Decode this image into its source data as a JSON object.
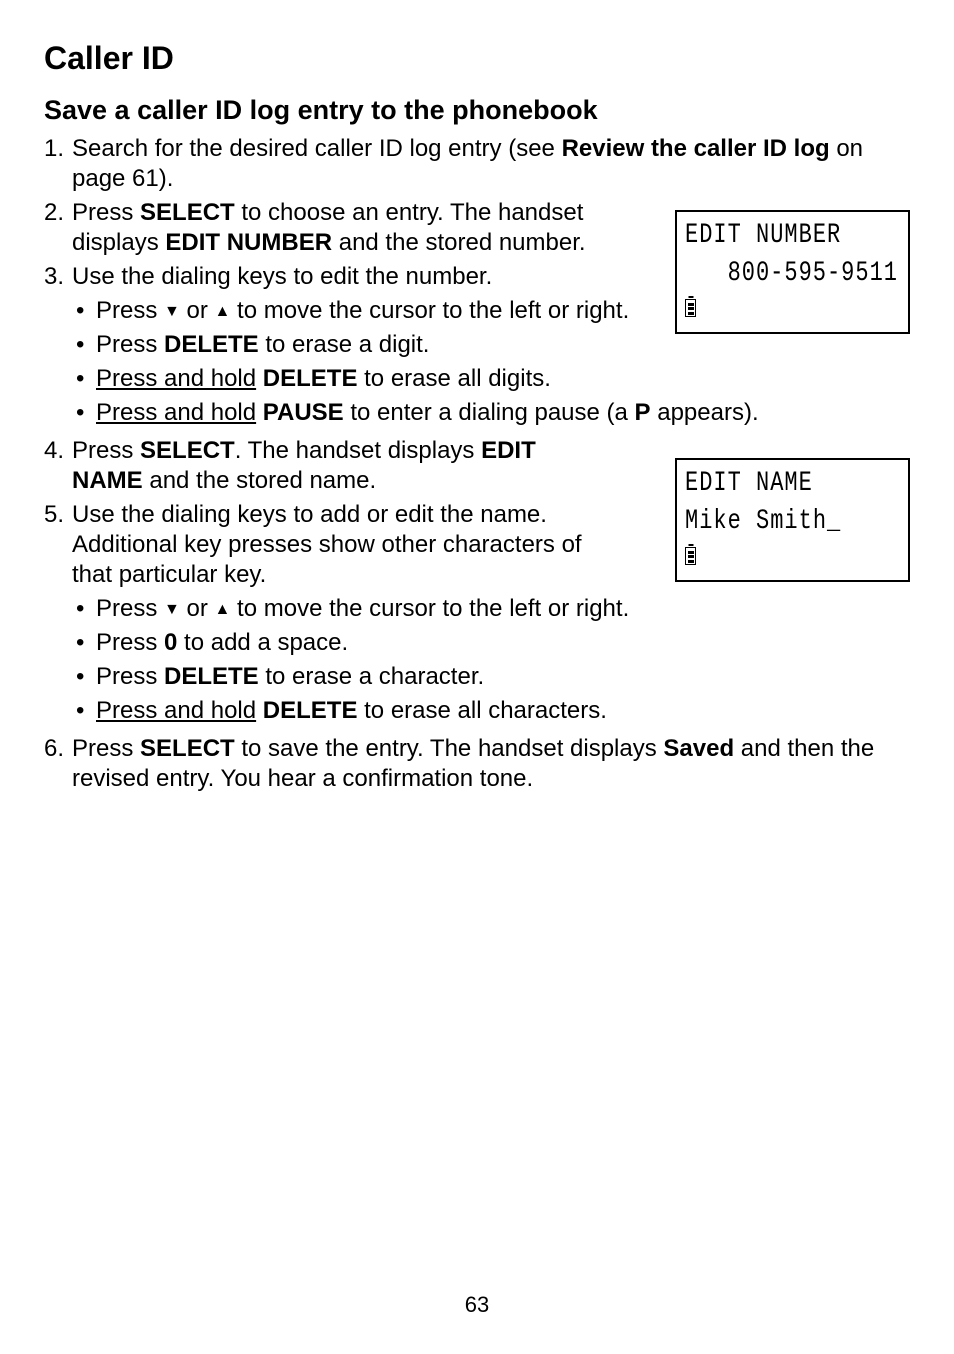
{
  "page": {
    "title_h1": "Caller ID",
    "title_h2": "Save a caller ID log entry to the phonebook",
    "page_number": "63"
  },
  "steps": {
    "s1": {
      "num": "1.",
      "pre": "Search for the desired caller ID log entry (see ",
      "bold": "Review the caller ID log",
      "post": " on page 61)."
    },
    "s2": {
      "num": "2.",
      "pre": "Press ",
      "b1": "SELECT",
      "mid": " to choose an entry. The handset displays ",
      "b2": "EDIT NUMBER",
      "post": " and the stored number."
    },
    "s3": {
      "num": "3.",
      "text": "Use the dialing keys to edit the number.",
      "bullets": {
        "b1": {
          "pre": "Press ",
          "down": "▼",
          "mid1": " or ",
          "up": "▲",
          "post": " to move the cursor to the left or right."
        },
        "b2": {
          "pre": "Press ",
          "b": "DELETE",
          "post": " to erase a digit."
        },
        "b3": {
          "ul": "Press and hold",
          "sp": " ",
          "b": "DELETE",
          "post": " to erase all digits."
        },
        "b4": {
          "ul": "Press and hold",
          "sp": " ",
          "b": "PAUSE",
          "mid": " to enter a dialing pause (a ",
          "b2": "P",
          "post": " appears)."
        }
      }
    },
    "s4": {
      "num": "4.",
      "pre": "Press ",
      "b1": "SELECT",
      "mid": ". The handset displays ",
      "b2": "EDIT NAME",
      "post": " and the stored name."
    },
    "s5": {
      "num": "5.",
      "text": "Use the dialing keys to add or edit the name. Additional key presses show other characters of that particular key.",
      "bullets": {
        "b1": {
          "pre": "Press ",
          "down": "▼",
          "mid1": " or ",
          "up": "▲",
          "post": " to move the cursor to the left or right."
        },
        "b2": {
          "pre": "Press ",
          "b": "0",
          "post": " to add a space."
        },
        "b3": {
          "pre": "Press ",
          "b": "DELETE",
          "post": " to erase a character."
        },
        "b4": {
          "ul": "Press and hold",
          "sp": " ",
          "b": "DELETE",
          "post": " to erase all characters."
        }
      }
    },
    "s6": {
      "num": "6.",
      "pre": "Press ",
      "b1": "SELECT",
      "mid": " to save the entry. The handset displays ",
      "b2": "Saved",
      "post": " and then the revised entry. You hear a confirmation tone."
    }
  },
  "lcd": {
    "panel1": {
      "line1": "EDIT NUMBER",
      "line2": "800-595-9511"
    },
    "panel2": {
      "line1": "EDIT NAME",
      "line2": "Mike Smith_"
    }
  },
  "glyphs": {
    "bullet": "•"
  }
}
